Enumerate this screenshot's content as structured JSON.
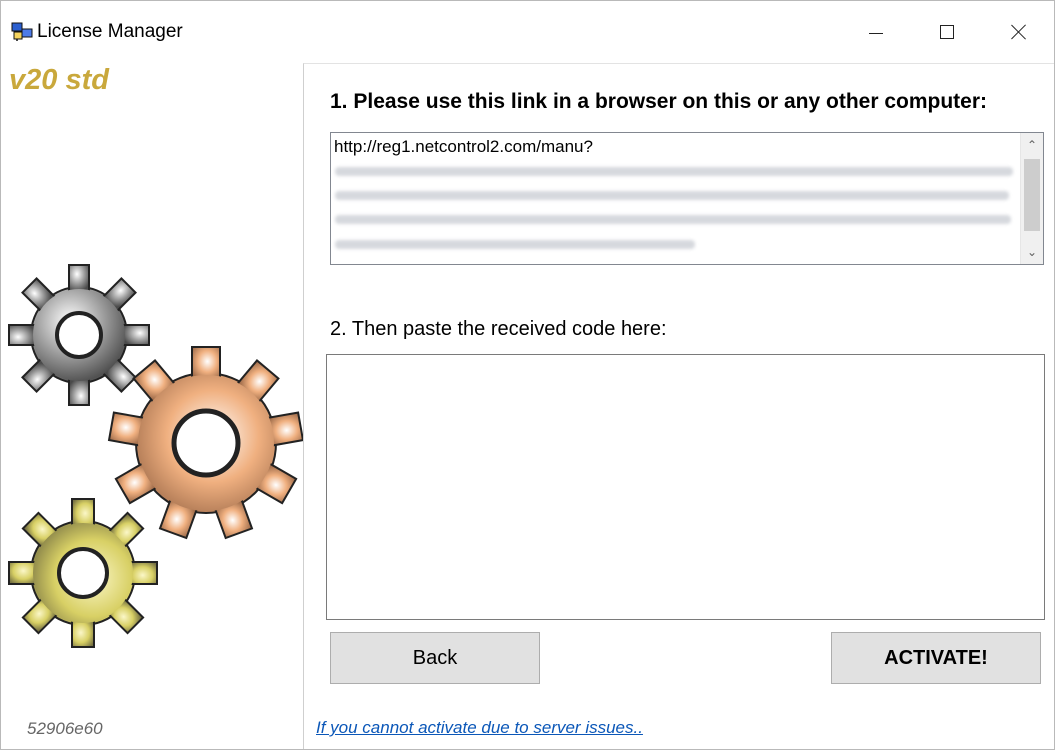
{
  "window": {
    "title": "License Manager",
    "minimize_icon": "minimize-icon",
    "maximize_icon": "maximize-icon",
    "close_icon": "close-icon",
    "app_icon": "license-app-icon"
  },
  "sidebar": {
    "version": "v20 std",
    "build_id": "52906e60",
    "graphic": "gears-icon",
    "accent_color": "#c9a83c"
  },
  "main": {
    "step1_label": "1. Please use this link in a browser on this or any other computer:",
    "link_text": "http://reg1.netcontrol2.com/manu?",
    "step2_label": "2. Then paste the received code here:",
    "code_value": "",
    "back_label": "Back",
    "activate_label": "ACTIVATE!",
    "server_issues_link": "If you cannot activate due to server issues.."
  }
}
